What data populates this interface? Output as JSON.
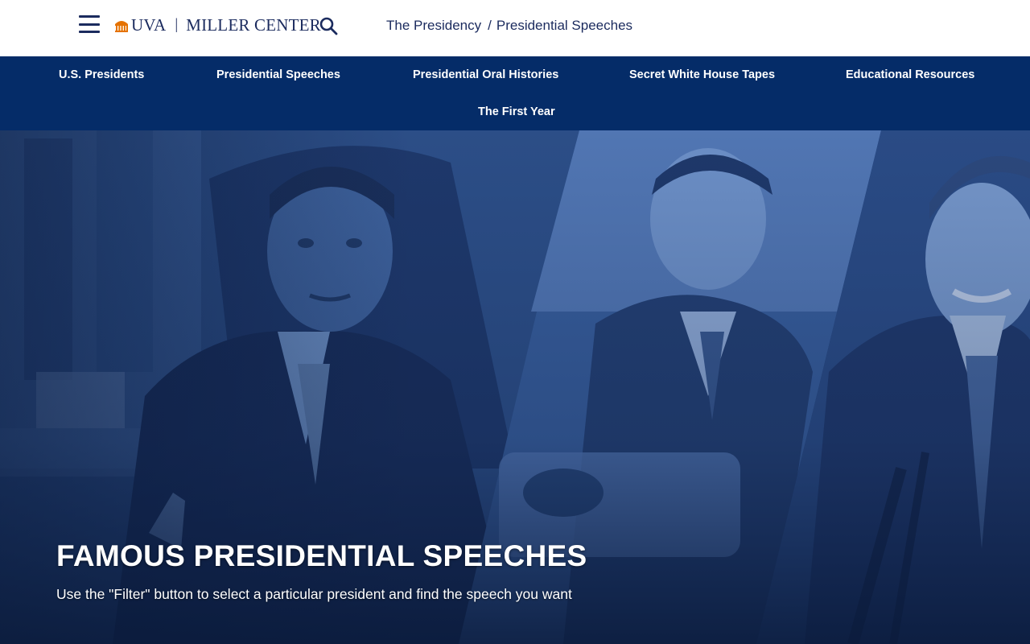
{
  "header": {
    "logo_uva": "UVA",
    "logo_divider": "|",
    "logo_org": "MILLER CENTER",
    "breadcrumb": {
      "parent": "The Presidency",
      "separator": "/",
      "current": "Presidential Speeches"
    }
  },
  "nav": {
    "items": [
      {
        "label": "U.S. Presidents"
      },
      {
        "label": "Presidential Speeches"
      },
      {
        "label": "Presidential Oral Histories"
      },
      {
        "label": "Secret White House Tapes"
      },
      {
        "label": "Educational Resources"
      },
      {
        "label": "The First Year"
      }
    ]
  },
  "hero": {
    "title": "FAMOUS PRESIDENTIAL SPEECHES",
    "subtitle": "Use the \"Filter\" button to select a particular president and find the speech you want"
  },
  "colors": {
    "brand_navy": "#1b2b5e",
    "nav_background": "#052c68",
    "uva_orange": "#e57200",
    "hero_tint": "#2a4f8f"
  },
  "icons": [
    "hamburger-menu-icon",
    "uva-rotunda-icon",
    "search-icon"
  ]
}
